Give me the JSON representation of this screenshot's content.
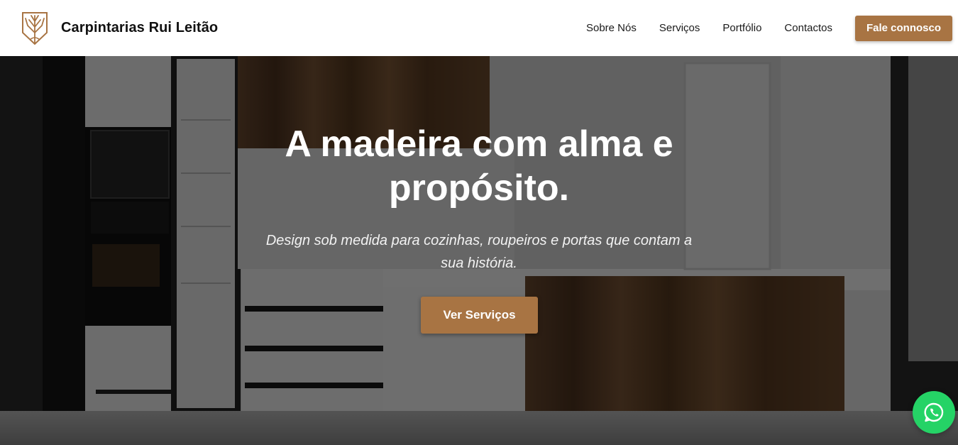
{
  "header": {
    "brand": "Carpintarias Rui Leitão",
    "nav": [
      {
        "label": "Sobre Nós"
      },
      {
        "label": "Serviços"
      },
      {
        "label": "Portfólio"
      },
      {
        "label": "Contactos"
      }
    ],
    "cta_label": "Fale connosco"
  },
  "hero": {
    "title": "A madeira com alma e propósito.",
    "subtitle": "Design sob medida para cozinhas, roupeiros e portas que contam a sua história.",
    "button_label": "Ver Serviços"
  },
  "colors": {
    "accent": "#a87443",
    "whatsapp": "#25d366"
  },
  "icons": {
    "logo": "tree-shield-logo",
    "floating": "whatsapp-icon"
  }
}
